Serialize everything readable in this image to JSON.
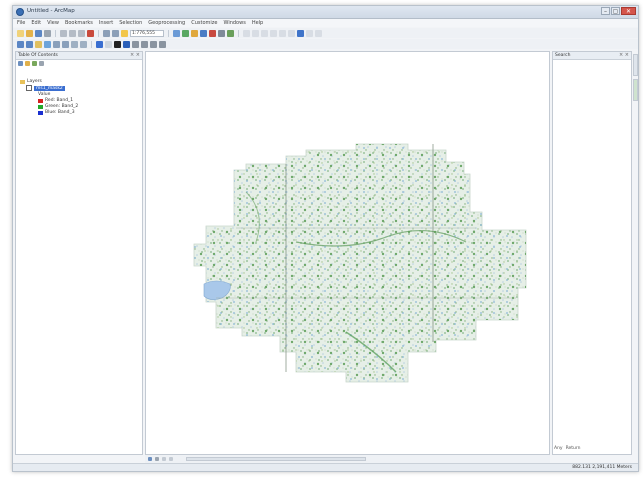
{
  "window": {
    "title": "Untitled - ArcMap",
    "buttons": [
      "–",
      "▢",
      "✕"
    ]
  },
  "menubar": [
    "File",
    "Edit",
    "View",
    "Bookmarks",
    "Insert",
    "Selection",
    "Geoprocessing",
    "Customize",
    "Windows",
    "Help"
  ],
  "toolbar": {
    "scale": "1:776,555"
  },
  "toc": {
    "title": "Table Of Contents",
    "close": "× ×",
    "root": "Layers",
    "layer_name": "ms1_mask2",
    "sublabel": "Value",
    "legend": [
      {
        "label": "Red: Band_1",
        "color": "#d62020"
      },
      {
        "label": "Green: Band_2",
        "color": "#22a82a"
      },
      {
        "label": "Blue: Band_3",
        "color": "#1a2fd0"
      }
    ]
  },
  "right_panel": {
    "title": "Search",
    "search_any": "Any",
    "return_label": "Return"
  },
  "status": {
    "coords": "882.131  2,191,411 Meters"
  },
  "colors": {
    "accent": "#3a6ed0",
    "map_fill": "#cfe3d4",
    "close_btn": "#d4554b"
  }
}
